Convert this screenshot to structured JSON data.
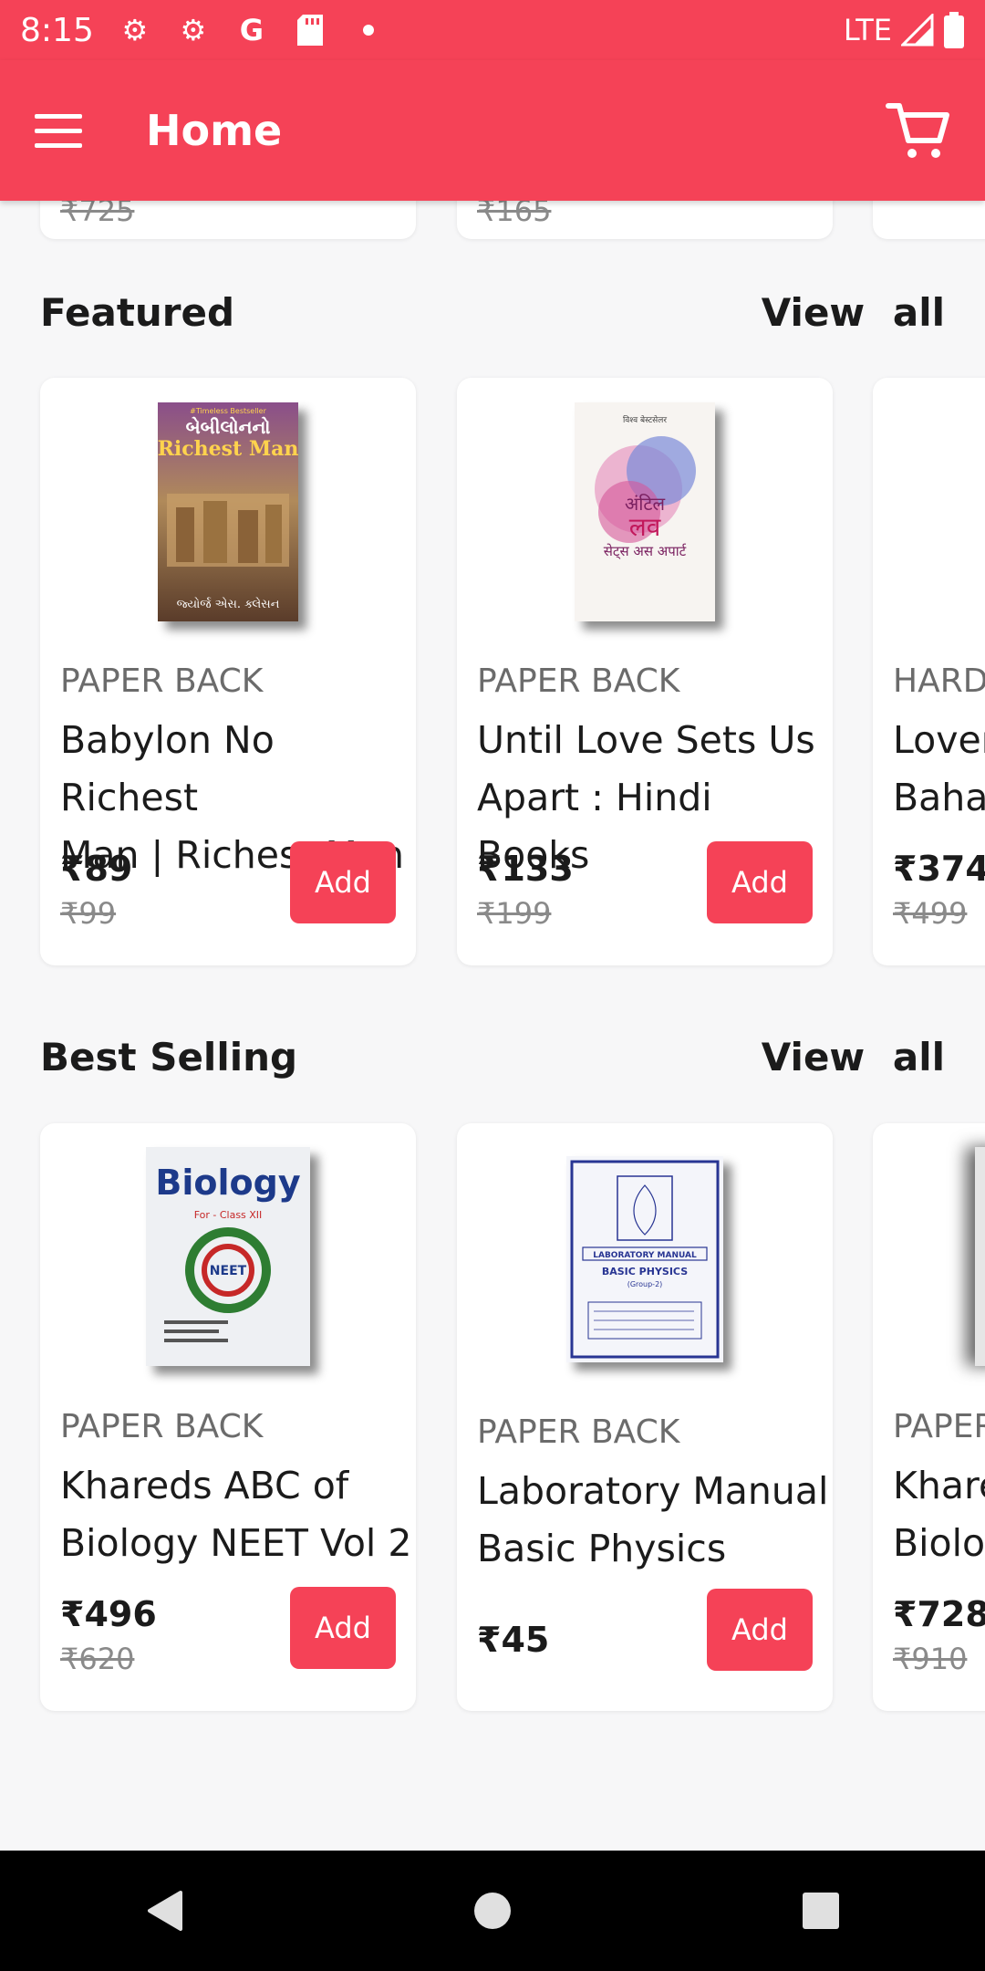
{
  "status_bar": {
    "time": "8:15",
    "network": "LTE",
    "notification_icons": [
      "gear-icon",
      "gear-icon",
      "google-icon",
      "sd-card-icon",
      "dot-icon"
    ]
  },
  "app_bar": {
    "title": "Home",
    "color": "#f54257"
  },
  "top_partial": {
    "prices": [
      "₹725",
      "₹165"
    ]
  },
  "featured": {
    "title": "Featured",
    "view_all": "View all",
    "items": [
      {
        "binding": "PAPER BACK",
        "title": "Babylon No Richest\nMan | Richest Man",
        "price": "₹89",
        "mrp": "₹99",
        "add": "Add",
        "cover": {
          "top": "#Timeless Bestseller",
          "line1": "બેબીલોનનો",
          "line2": "Richest Man",
          "author": "જ્યોર્જ એસ. ક્લેસન"
        }
      },
      {
        "binding": "PAPER BACK",
        "title": "Until Love Sets Us\nApart : Hindi Books",
        "price": "₹133",
        "mrp": "₹199",
        "add": "Add",
        "cover": {
          "line1": "अंटिल",
          "line2": "लव",
          "line3": "सेट्स अस अपार्ट"
        }
      },
      {
        "binding": "HARD",
        "title": "Lover\nBahav",
        "price": "₹374",
        "mrp": "₹499",
        "add": "Add"
      }
    ]
  },
  "best_selling": {
    "title": "Best Selling",
    "view_all": "View all",
    "items": [
      {
        "binding": "PAPER BACK",
        "title": "Khareds ABC of\nBiology NEET Vol 2",
        "price": "₹496",
        "mrp": "₹620",
        "add": "Add",
        "cover": {
          "title": "Biology",
          "sub": "For - Class XII",
          "badge": "NEET"
        }
      },
      {
        "binding": "PAPER BACK",
        "title": "Laboratory Manual\nBasic Physics",
        "price": "₹45",
        "mrp": "",
        "add": "Add",
        "cover": {
          "line1": "LABORATORY MANUAL",
          "line2": "BASIC PHYSICS",
          "line3": "(Group-2)"
        }
      },
      {
        "binding": "PAPER",
        "title": "Khare\nBiolog",
        "price": "₹728",
        "mrp": "₹910",
        "add": "Add"
      }
    ]
  }
}
